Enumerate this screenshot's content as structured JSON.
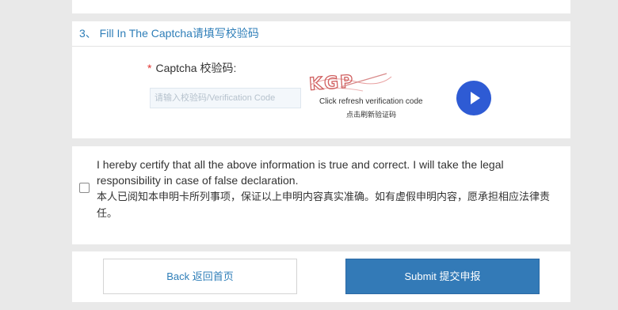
{
  "section": {
    "title": "3、 Fill In The Captcha请填写校验码"
  },
  "captcha": {
    "required_mark": "*",
    "label": "Captcha 校验码:",
    "placeholder": "请输入校验码/Verification Code",
    "image_text": "KGP",
    "refresh_hint_en": "Click refresh verification code",
    "refresh_hint_zh": "点击刷新验证码",
    "audio_icon": "play-icon"
  },
  "declaration": {
    "checked": false,
    "text_en": "I hereby certify that all the above information is true and correct. I will take the legal responsibility in case of false declaration.",
    "text_zh": "本人已阅知本申明卡所列事项，保证以上申明内容真实准确。如有虚假申明内容，愿承担相应法律责任。"
  },
  "actions": {
    "back_label": "Back 返回首页",
    "submit_label": "Submit 提交申报"
  },
  "colors": {
    "accent": "#2e7eb8",
    "submit": "#337ab7",
    "play": "#2e5bd4",
    "required": "#e0322f",
    "captcha_glyphs": "#d06060"
  }
}
